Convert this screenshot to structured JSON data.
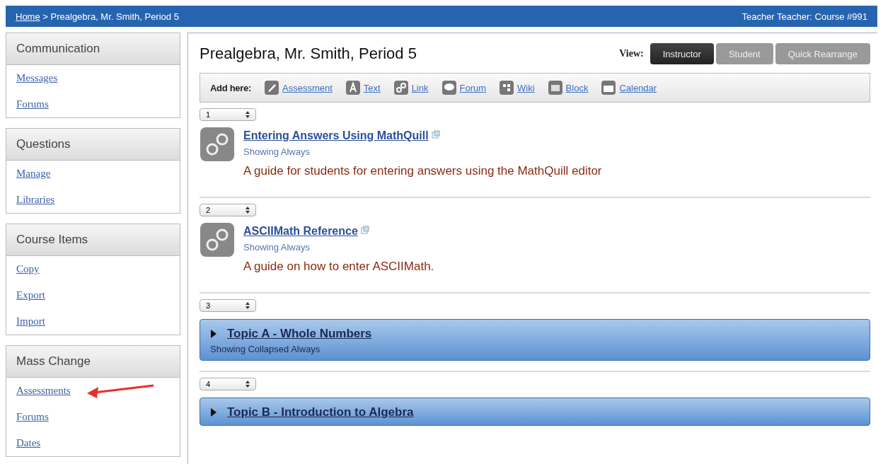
{
  "breadcrumb": {
    "home": "Home",
    "separator": ">",
    "current": "Prealgebra, Mr. Smith, Period 5"
  },
  "user_info": "Teacher Teacher: Course #991",
  "sidebar": [
    {
      "title": "Communication",
      "items": [
        "Messages",
        "Forums"
      ]
    },
    {
      "title": "Questions",
      "items": [
        "Manage",
        "Libraries"
      ]
    },
    {
      "title": "Course Items",
      "items": [
        "Copy",
        "Export",
        "Import"
      ]
    },
    {
      "title": "Mass Change",
      "items": [
        "Assessments",
        "Forums",
        "Dates"
      ]
    }
  ],
  "course_title": "Prealgebra, Mr. Smith, Period 5",
  "view": {
    "label": "View:",
    "options": [
      {
        "label": "Instructor",
        "selected": true
      },
      {
        "label": "Student",
        "selected": false
      },
      {
        "label": "Quick Rearrange",
        "selected": false
      }
    ]
  },
  "add_here": {
    "label": "Add here:",
    "items": [
      {
        "kind": "assessment",
        "label": "Assessment"
      },
      {
        "kind": "text",
        "label": "Text"
      },
      {
        "kind": "link",
        "label": "Link"
      },
      {
        "kind": "forum",
        "label": "Forum"
      },
      {
        "kind": "wiki",
        "label": "Wiki"
      },
      {
        "kind": "block",
        "label": "Block"
      },
      {
        "kind": "calendar",
        "label": "Calendar"
      }
    ]
  },
  "items": [
    {
      "order": "1",
      "kind": "link",
      "title": "Entering Answers Using MathQuill",
      "status": "Showing Always",
      "description": "A guide for students for entering answers using the MathQuill editor"
    },
    {
      "order": "2",
      "kind": "link",
      "title": "ASCIIMath Reference",
      "status": "Showing Always",
      "description": "A guide on how to enter ASCIIMath."
    },
    {
      "order": "3",
      "kind": "block",
      "title": "Topic A - Whole Numbers",
      "status": "Showing Collapsed Always"
    },
    {
      "order": "4",
      "kind": "block",
      "title": "Topic B - Introduction to Algebra"
    }
  ]
}
